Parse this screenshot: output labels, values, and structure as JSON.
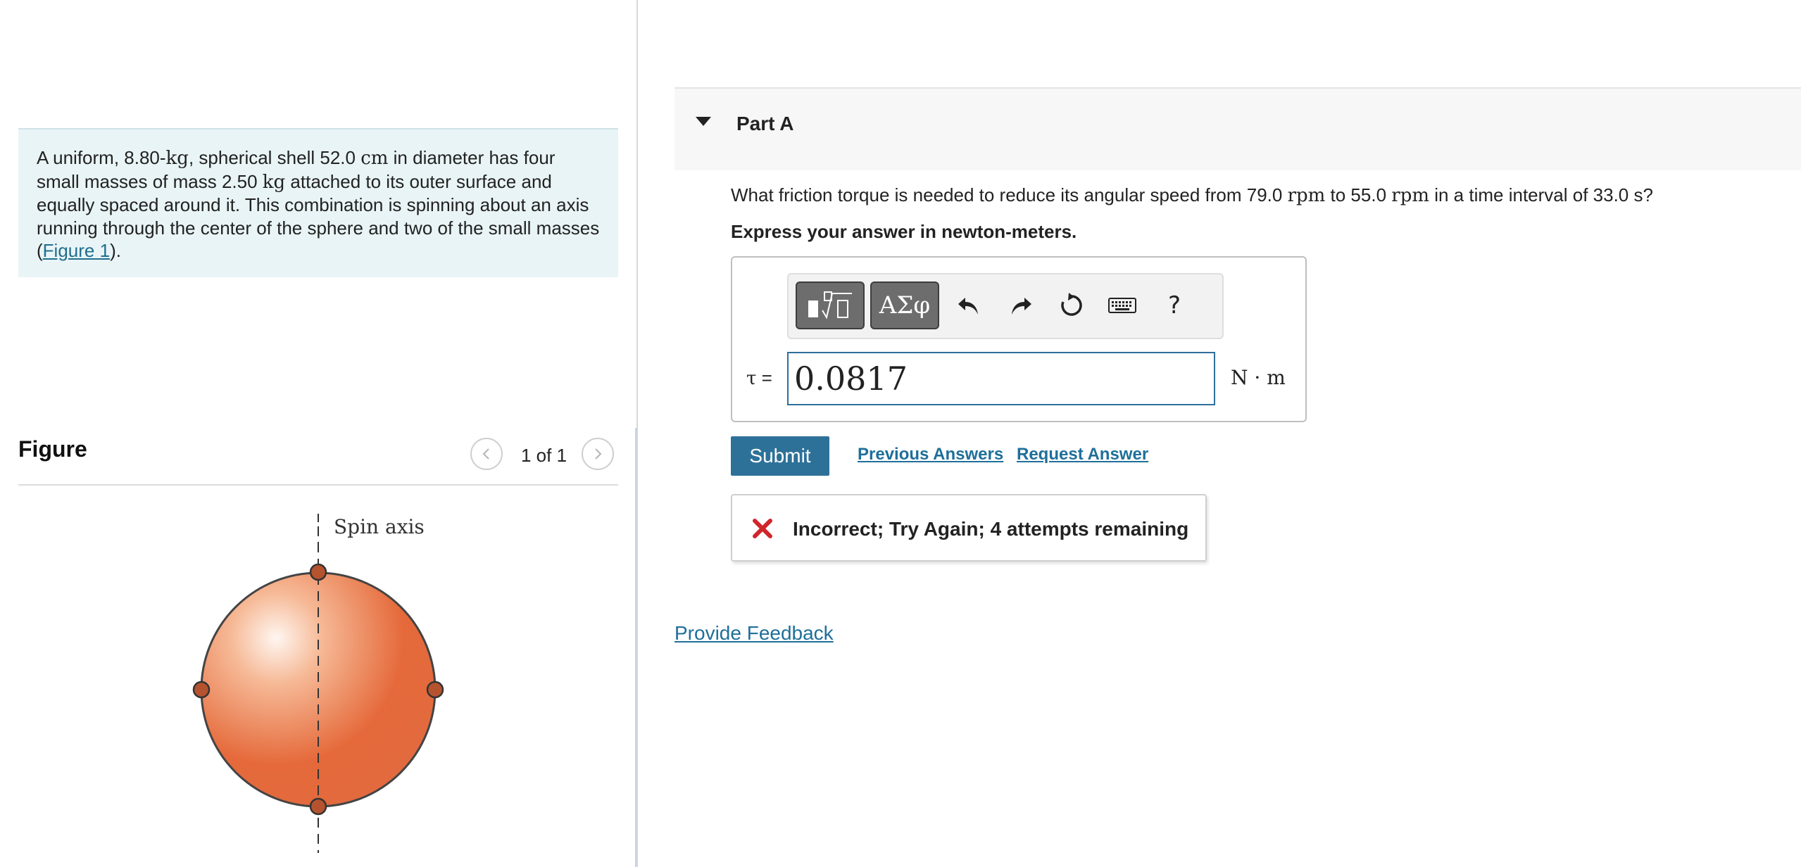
{
  "problem": {
    "text_1": "A uniform, 8.80-",
    "unit_kg_1": "kg",
    "text_2": ", spherical shell 52.0 ",
    "unit_cm": "cm",
    "text_3": " in diameter has four small masses of mass 2.50 ",
    "unit_kg_2": "kg",
    "text_4": " attached to its outer surface and equally spaced around it. This combination is spinning about an axis running through the center of the sphere and two of the small masses (",
    "figure_link": "Figure 1",
    "text_5": ")."
  },
  "figure_panel": {
    "title": "Figure",
    "counter": "1 of 1",
    "axis_label": "Spin axis",
    "colors": {
      "sphere": "#e56a3c",
      "mass": "#b5532e"
    }
  },
  "part": {
    "title": "Part A"
  },
  "question": {
    "text_1": "What friction torque is needed to reduce its angular speed from 79.0 ",
    "unit_rpm_1": "rpm",
    "text_2": " to 55.0 ",
    "unit_rpm_2": "rpm",
    "text_3": " in a time interval of 33.0 s?",
    "instruction": "Express your answer in newton-meters."
  },
  "answer": {
    "variable": "τ",
    "equals": " =",
    "value": "0.0817",
    "units": "N · m"
  },
  "toolbar": {
    "greek_label": "ΑΣφ",
    "help_label": "?",
    "icons": [
      "template-icon",
      "greek-icon",
      "undo-icon",
      "redo-icon",
      "reset-icon",
      "keyboard-icon",
      "help-icon"
    ]
  },
  "actions": {
    "submit": "Submit",
    "previous_answers": "Previous Answers",
    "request_answer": "Request Answer"
  },
  "feedback": {
    "message": "Incorrect; Try Again; 4 attempts remaining",
    "status_color": "#d0262b"
  },
  "footer": {
    "provide_feedback": "Provide Feedback"
  },
  "colors": {
    "accent": "#2d7199",
    "problem_bg": "#e9f4f6",
    "link": "#1f6f9a"
  }
}
